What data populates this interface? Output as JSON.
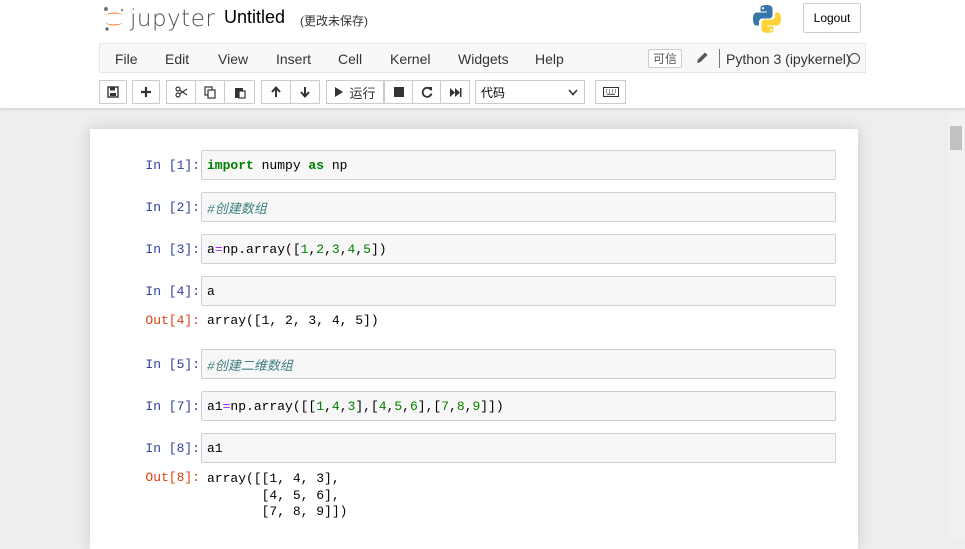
{
  "header": {
    "logo_text": "jupyter",
    "notebook_name": "Untitled",
    "save_status": "(更改未保存)",
    "logout_label": "Logout"
  },
  "menubar": {
    "items": [
      "File",
      "Edit",
      "View",
      "Insert",
      "Cell",
      "Kernel",
      "Widgets",
      "Help"
    ],
    "trusted_label": "可信",
    "kernel_name": "Python 3 (ipykernel)"
  },
  "toolbar": {
    "run_label": "运行",
    "cell_type": "代码",
    "icons": [
      "save-icon",
      "plus-icon",
      "cut-icon",
      "copy-icon",
      "paste-icon",
      "arrow-up-icon",
      "arrow-down-icon",
      "play-icon",
      "stop-icon",
      "restart-icon",
      "fast-forward-icon",
      "keyboard-icon"
    ]
  },
  "cells": [
    {
      "prompt": "In  [1]:",
      "tokens": [
        [
          "import",
          "kw"
        ],
        [
          " numpy ",
          ""
        ],
        [
          "as",
          "kw"
        ],
        [
          " np",
          ""
        ]
      ]
    },
    {
      "prompt": "In  [2]:",
      "tokens": [
        [
          "#创建数组",
          "cm"
        ]
      ]
    },
    {
      "prompt": "In  [3]:",
      "tokens": [
        [
          "a",
          ""
        ],
        [
          "=",
          "op"
        ],
        [
          "np.array([",
          ""
        ],
        [
          "1",
          "num"
        ],
        [
          ",",
          ""
        ],
        [
          "2",
          "num"
        ],
        [
          ",",
          ""
        ],
        [
          "3",
          "num"
        ],
        [
          ",",
          ""
        ],
        [
          "4",
          "num"
        ],
        [
          ",",
          ""
        ],
        [
          "5",
          "num"
        ],
        [
          "])",
          ""
        ]
      ]
    },
    {
      "prompt": "In  [4]:",
      "tokens": [
        [
          "a",
          ""
        ]
      ],
      "out_prompt": "Out[4]:",
      "output": "array([1, 2, 3, 4, 5])"
    },
    {
      "prompt": "In  [5]:",
      "tokens": [
        [
          "#创建二维数组",
          "cm"
        ]
      ]
    },
    {
      "prompt": "In  [7]:",
      "tokens": [
        [
          "a1",
          ""
        ],
        [
          "=",
          "op"
        ],
        [
          "np.array([[",
          ""
        ],
        [
          "1",
          "num"
        ],
        [
          ",",
          ""
        ],
        [
          "4",
          "num"
        ],
        [
          ",",
          ""
        ],
        [
          "3",
          "num"
        ],
        [
          "],[",
          ""
        ],
        [
          "4",
          "num"
        ],
        [
          ",",
          ""
        ],
        [
          "5",
          "num"
        ],
        [
          ",",
          ""
        ],
        [
          "6",
          "num"
        ],
        [
          "],[",
          ""
        ],
        [
          "7",
          "num"
        ],
        [
          ",",
          ""
        ],
        [
          "8",
          "num"
        ],
        [
          ",",
          ""
        ],
        [
          "9",
          "num"
        ],
        [
          "]])",
          ""
        ]
      ]
    },
    {
      "prompt": "In  [8]:",
      "tokens": [
        [
          "a1",
          ""
        ]
      ],
      "out_prompt": "Out[8]:",
      "output": "array([[1, 4, 3],\n       [4, 5, 6],\n       [7, 8, 9]])"
    }
  ],
  "colors": {
    "in_prompt": "#303f9f",
    "out_prompt": "#d84315",
    "keyword": "#008000",
    "comment": "#408080"
  }
}
